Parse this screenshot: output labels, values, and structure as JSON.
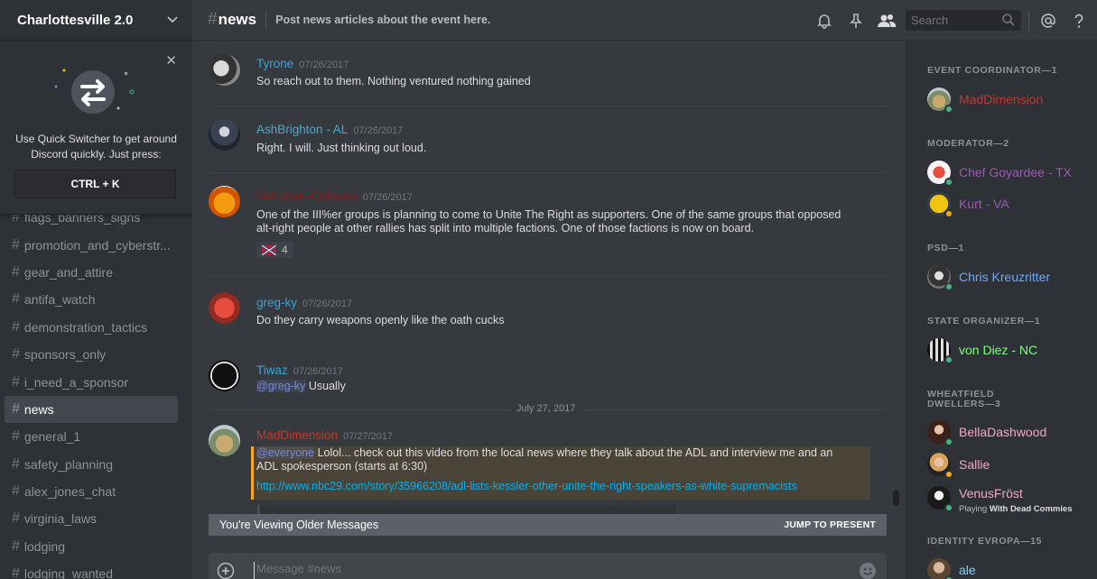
{
  "sidebar": {
    "server_name": "Charlottesville 2.0",
    "quick_switcher": {
      "text": "Use Quick Switcher to get around Discord quickly. Just press:",
      "shortcut": "CTRL + K"
    },
    "channels": [
      {
        "name": "flags_banners_signs",
        "active": false
      },
      {
        "name": "promotion_and_cyberstr...",
        "active": false
      },
      {
        "name": "gear_and_attire",
        "active": false
      },
      {
        "name": "antifa_watch",
        "active": false
      },
      {
        "name": "demonstration_tactics",
        "active": false
      },
      {
        "name": "sponsors_only",
        "active": false
      },
      {
        "name": "i_need_a_sponsor",
        "active": false
      },
      {
        "name": "news",
        "active": true
      },
      {
        "name": "general_1",
        "active": false
      },
      {
        "name": "safety_planning",
        "active": false
      },
      {
        "name": "alex_jones_chat",
        "active": false
      },
      {
        "name": "virginia_laws",
        "active": false
      },
      {
        "name": "lodging",
        "active": false
      },
      {
        "name": "lodging_wanted",
        "active": false
      }
    ]
  },
  "header": {
    "channel": "news",
    "topic": "Post news articles about the event here.",
    "search_placeholder": "Search"
  },
  "messages": [
    {
      "user": "Tyrone",
      "color": "#3ba3d6",
      "time": "07/26/2017",
      "lines": [
        "So reach out to them. Nothing ventured nothing gained"
      ]
    },
    {
      "user": "AshBrighton - AL",
      "color": "#4fa9c8",
      "time": "07/26/2017",
      "lines": [
        "Right. I will. Just thinking out loud."
      ]
    },
    {
      "user": "Narrative-Collapse",
      "color": "#8a1c1c",
      "time": "07/26/2017",
      "lines": [
        "One of the III%er groups is planning to come to Unite The Right as supporters.  One of the same groups that opposed",
        "alt-right people at other rallies has split into multiple factions. One of those factions is now on board."
      ],
      "reaction_count": "4"
    },
    {
      "user": "greg-ky",
      "color": "#3ba3d6",
      "time": "07/26/2017",
      "lines": [
        "Do they carry weapons openly like the oath cucks"
      ]
    },
    {
      "user": "Tiwaz",
      "color": "#3ba3d6",
      "time": "07/26/2017",
      "mention": "@greg-ky",
      "after_mention": " Usually"
    },
    {
      "user": "MadDimension",
      "color": "#c0392b",
      "time": "07/27/2017",
      "mention": "@everyone",
      "after_mention": " Lolol... check out this video from the local news where they talk about the ADL and interview me and an",
      "line2": "ADL spokesperson (starts at 6:30)",
      "link": "http://www.nbc29.com/story/35966208/adl-lists-kessler-other-unite-the-right-speakers-as-white-supremacists"
    }
  ],
  "date_divider": "July 27, 2017",
  "older_bar": {
    "label": "You're Viewing Older Messages",
    "jump": "JUMP TO PRESENT"
  },
  "composer": {
    "placeholder": "Message #news"
  },
  "members": {
    "roles": [
      {
        "title": "EVENT COORDINATOR—1"
      },
      {
        "title": "MODERATOR—2"
      },
      {
        "title": "PSD—1"
      },
      {
        "title": "STATE ORGANIZER—1"
      },
      {
        "title": "WHEATFIELD DWELLERS—3"
      },
      {
        "title": "IDENTITY EVROPA—15"
      }
    ],
    "list": [
      {
        "name": "MadDimension",
        "color": "#c0392b",
        "status": "#43b581"
      },
      {
        "name": "Chef Goyardee - TX",
        "color": "#9b59b6",
        "status": "#43b581"
      },
      {
        "name": "Kurt - VA",
        "color": "#9b59b6",
        "status": "#faa61a"
      },
      {
        "name": "Chris Kreuzritter",
        "color": "#6fa8ff",
        "status": "#43b581"
      },
      {
        "name": "von Diez - NC",
        "color": "#7fff7f",
        "status": "#43b581"
      },
      {
        "name": "BellaDashwood",
        "color": "#f5a6c8",
        "status": "#43b581"
      },
      {
        "name": "Sallie",
        "color": "#f5a6c8",
        "status": "#faa61a"
      },
      {
        "name": "VenusFröst",
        "color": "#f5a6c8",
        "status": "#43b581",
        "playing_prefix": "Playing ",
        "playing_game": "With Dead Commies"
      },
      {
        "name": "ale",
        "color": "#7fd3ff",
        "status": "#43b581"
      }
    ]
  }
}
